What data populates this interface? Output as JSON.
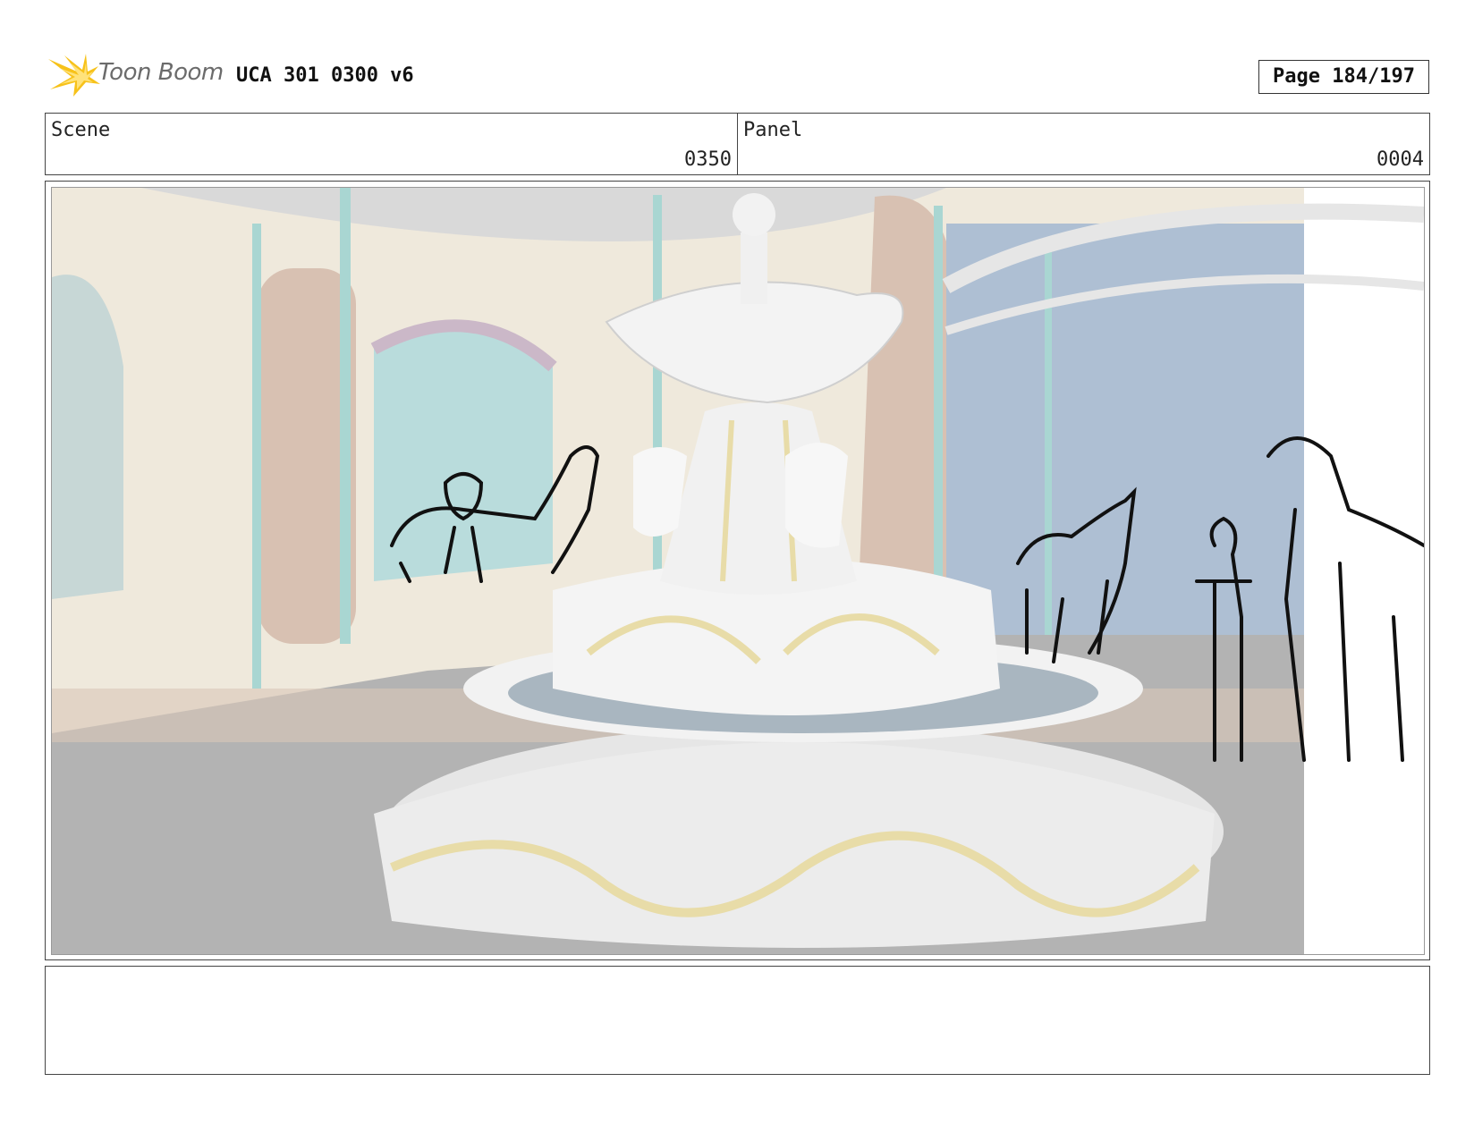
{
  "header": {
    "logo_text": "Toon Boom",
    "title": "UCA 301 0300 v6",
    "page": "Page 184/197"
  },
  "info": {
    "scene_label": "Scene",
    "scene_value": "0350",
    "panel_label": "Panel",
    "panel_value": "0004"
  },
  "notes": {
    "text": ""
  }
}
